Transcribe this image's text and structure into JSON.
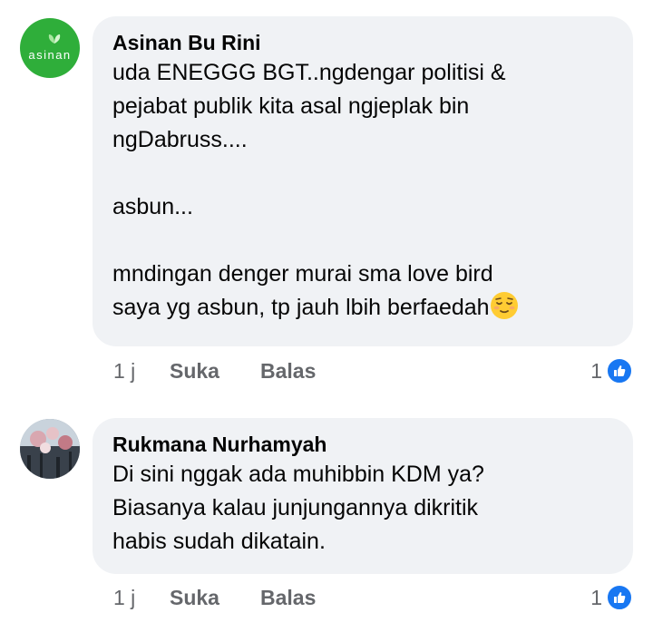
{
  "comments": [
    {
      "author": "Asinan Bu Rini",
      "avatar_logo_text": "asinan",
      "text": "uda ENEGGG BGT..ngdengar politisi &\npejabat publik kita asal ngjeplak bin\nngDabruss....\n\nasbun...\n\nmndingan denger murai sma love bird\nsaya yg asbun, tp jauh lbih berfaedah",
      "emoji": "relieved-face",
      "time": "1 j",
      "like_label": "Suka",
      "reply_label": "Balas",
      "reaction_count": "1",
      "reaction_icon": "thumbs-up-icon"
    },
    {
      "author": "Rukmana Nurhamyah",
      "text": "Di sini nggak ada muhibbin KDM ya?\nBiasanya kalau junjungannya dikritik\nhabis sudah dikatain.",
      "time": "1 j",
      "like_label": "Suka",
      "reply_label": "Balas",
      "reaction_count": "1",
      "reaction_icon": "thumbs-up-icon"
    }
  ],
  "colors": {
    "bubble": "#f0f2f5",
    "avatar_green": "#2fae3a",
    "like_blue": "#1877f2",
    "meta_gray": "#65676b"
  }
}
